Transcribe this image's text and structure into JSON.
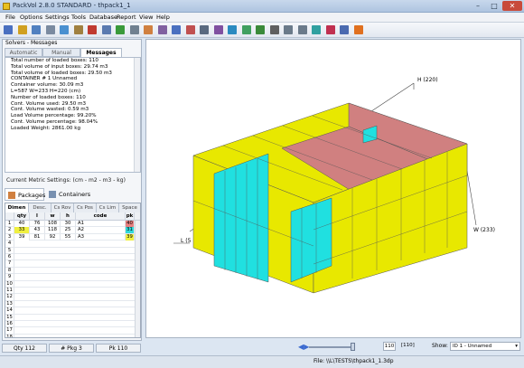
{
  "window": {
    "title": "PackVol 2.8.0 STANDARD - thpack1_1",
    "min": "–",
    "max": "□",
    "close": "✕"
  },
  "menu": [
    "File",
    "Options",
    "Settings",
    "Tools",
    "Database",
    "Report",
    "View",
    "Help"
  ],
  "toolbar_icons": [
    "new-icon",
    "open-icon",
    "save-icon",
    "cut-icon",
    "copy-icon",
    "paste-icon",
    "delete-icon",
    "undo-icon",
    "solve-icon",
    "settings-icon",
    "box-icon",
    "pallet-icon",
    "container-icon",
    "truck-icon",
    "print-icon",
    "report-icon",
    "chart-icon",
    "export-icon",
    "refresh-icon",
    "power-icon",
    "view3d-icon",
    "view2d-icon",
    "layers-icon",
    "options-icon",
    "grid-icon",
    "help-icon"
  ],
  "solvers": {
    "title": "Solvers - Messages",
    "tabs": [
      "Automatic",
      "Manual",
      "Messages"
    ],
    "active_tab": "Messages",
    "messages": [
      "Total number of loaded boxes: 110",
      "Total volume of input boxes: 29.74 m3",
      "Total volume of loaded boxes: 29.50 m3",
      "CONTAINER # 1 Unnamed",
      "Container volume:     30.09 m3",
      "L=587 W=233 H=220 (cm)",
      "Number of loaded boxes: 110",
      "Cont. Volume used:   29.50 m3",
      "Cont. Volume wasted: 0.59 m3",
      "Load Volume percentage: 99.20%",
      "Cont. Volume percentage: 98.04%",
      "Loaded Weight: 2861.00 kg"
    ]
  },
  "metric": "Current Metric Settings: (cm - m2 - m3 - kg)",
  "pack_tabs": {
    "packages": "Packages",
    "containers": "Containers"
  },
  "grid": {
    "tabs": [
      "Dimen",
      "Desc.",
      "Cs Rov",
      "Cs Pos",
      "Cs Lim",
      "Space"
    ],
    "headers": [
      "",
      "qty",
      "l",
      "w",
      "h",
      "code",
      "pk"
    ],
    "rows": [
      {
        "n": "1",
        "qty": "40",
        "l": "76",
        "w": "108",
        "h": "30",
        "code": "A1",
        "pk": "40",
        "qty_color": "#ffffff",
        "pk_color": "#e88080"
      },
      {
        "n": "2",
        "qty": "33",
        "l": "43",
        "w": "118",
        "h": "25",
        "code": "A2",
        "pk": "31",
        "qty_color": "#f0f040",
        "pk_color": "#30d8d8"
      },
      {
        "n": "3",
        "qty": "39",
        "l": "81",
        "w": "92",
        "h": "55",
        "code": "A3",
        "pk": "39",
        "qty_color": "#ffffff",
        "pk_color": "#f0f040"
      }
    ],
    "empty_rows": [
      "4",
      "5",
      "6",
      "7",
      "8",
      "9",
      "10",
      "11",
      "12",
      "13",
      "14",
      "15",
      "16",
      "17",
      "18",
      "19"
    ]
  },
  "status_left": {
    "qty": "Qty 112",
    "pkg": "# Pkg 3",
    "pk": "Pk 110"
  },
  "view": {
    "label_h": "H (220)",
    "label_w": "W (233)",
    "label_l": "L (5"
  },
  "slider": {
    "value": "110",
    "max": "[110]"
  },
  "show": {
    "label": "Show:",
    "value": "ID 1 - Unnamed"
  },
  "status_file": "File: \\\\L\\TESTS\\thpack1_1.3dp",
  "colors": {
    "yellow": "#e8e800",
    "cyan": "#20e0e0",
    "pink": "#d08080"
  }
}
